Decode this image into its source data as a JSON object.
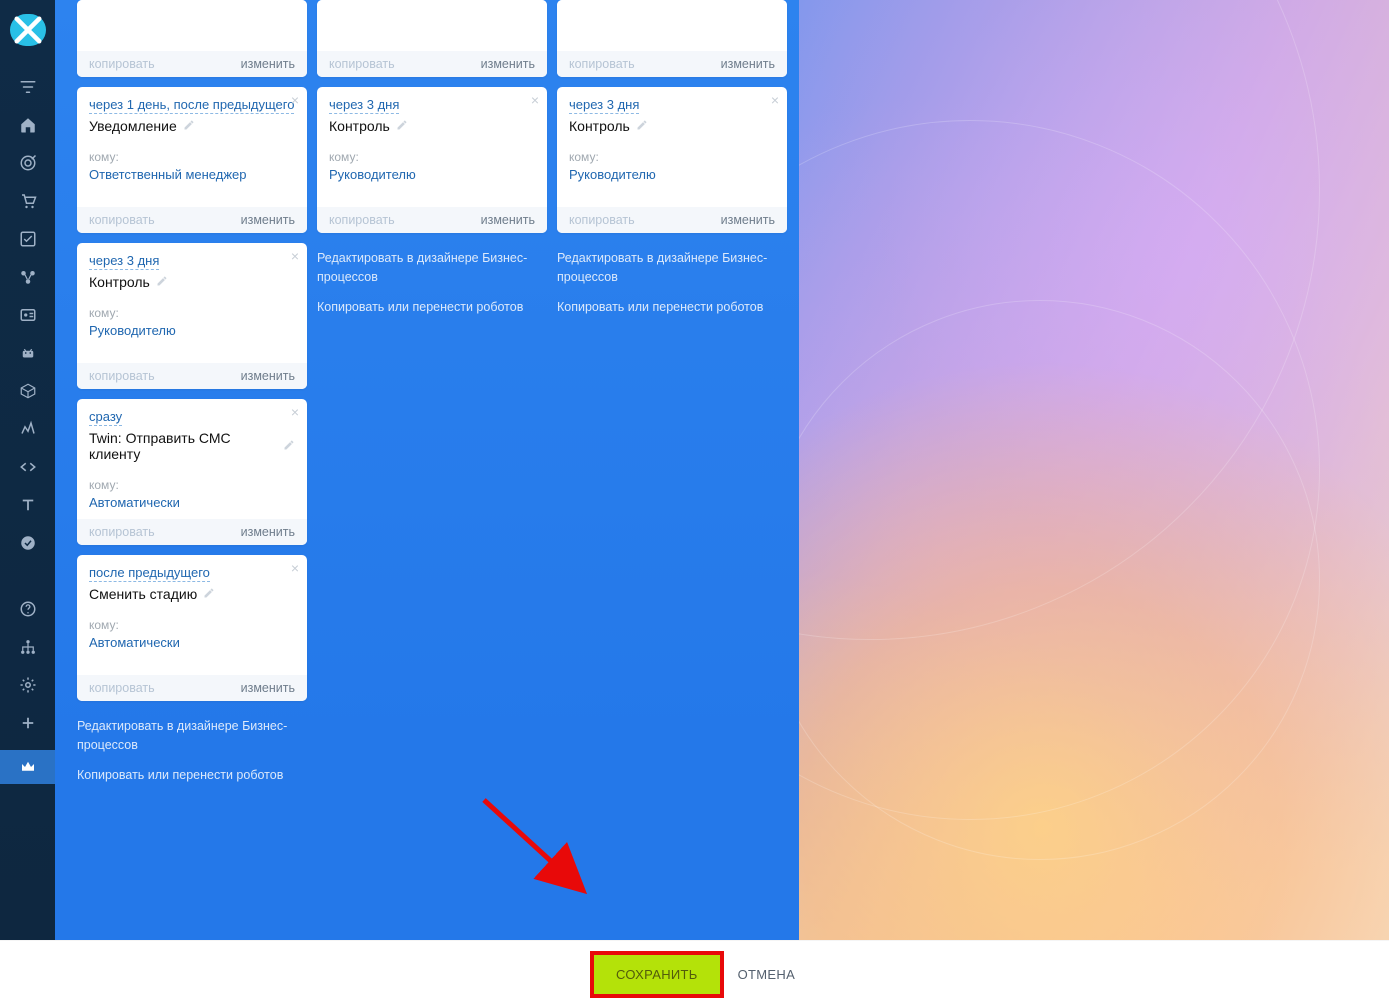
{
  "labels": {
    "copy": "копировать",
    "edit": "изменить",
    "to": "кому:",
    "designer": "Редактировать в дизайнере Бизнес-процессов",
    "copyRobots": "Копировать или перенести роботов",
    "save": "СОХРАНИТЬ",
    "cancel": "ОТМЕНА"
  },
  "columns": [
    {
      "cards": [
        {
          "stub": true
        },
        {
          "timing": "через 1 день, после предыдущего",
          "title": "Уведомление",
          "to": "Ответственный менеджер"
        },
        {
          "timing": "через 3 дня",
          "title": "Контроль",
          "to": "Руководителю"
        },
        {
          "timing": "сразу",
          "title": "Twin: Отправить СМС клиенту",
          "to": "Автоматически"
        },
        {
          "timing": "после предыдущего",
          "title": "Сменить стадию",
          "to": "Автоматически"
        }
      ],
      "links": true
    },
    {
      "cards": [
        {
          "stub": true
        },
        {
          "timing": "через 3 дня",
          "title": "Контроль",
          "to": "Руководителю"
        }
      ],
      "links": true
    },
    {
      "cards": [
        {
          "stub": true
        },
        {
          "timing": "через 3 дня",
          "title": "Контроль",
          "to": "Руководителю"
        }
      ],
      "links": true
    }
  ]
}
